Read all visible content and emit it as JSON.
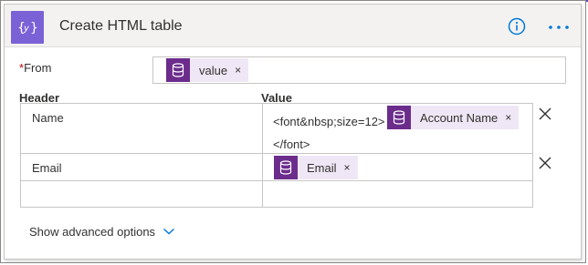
{
  "action": {
    "title": "Create HTML table",
    "icon": "braces-variable-icon",
    "header_color": "#7b61d6"
  },
  "from": {
    "label": "From",
    "required_marker": "*",
    "token": {
      "label": "value",
      "icon": "database-icon",
      "remove": "×"
    }
  },
  "table": {
    "header_col_label": "Header",
    "value_col_label": "Value",
    "rows": [
      {
        "header": "Name",
        "value_prefix": "<font&nbsp;size=12>",
        "token": {
          "label": "Account Name",
          "icon": "database-icon",
          "remove": "×"
        },
        "value_suffix": "</font>"
      },
      {
        "header": "Email",
        "token": {
          "label": "Email",
          "icon": "database-icon",
          "remove": "×"
        }
      },
      {
        "header": "",
        "value": ""
      }
    ]
  },
  "advanced": {
    "label": "Show advanced options"
  },
  "colors": {
    "token_bg": "#efe7f5",
    "token_icon_bg": "#6b2c8c",
    "info_blue": "#0078d4"
  }
}
